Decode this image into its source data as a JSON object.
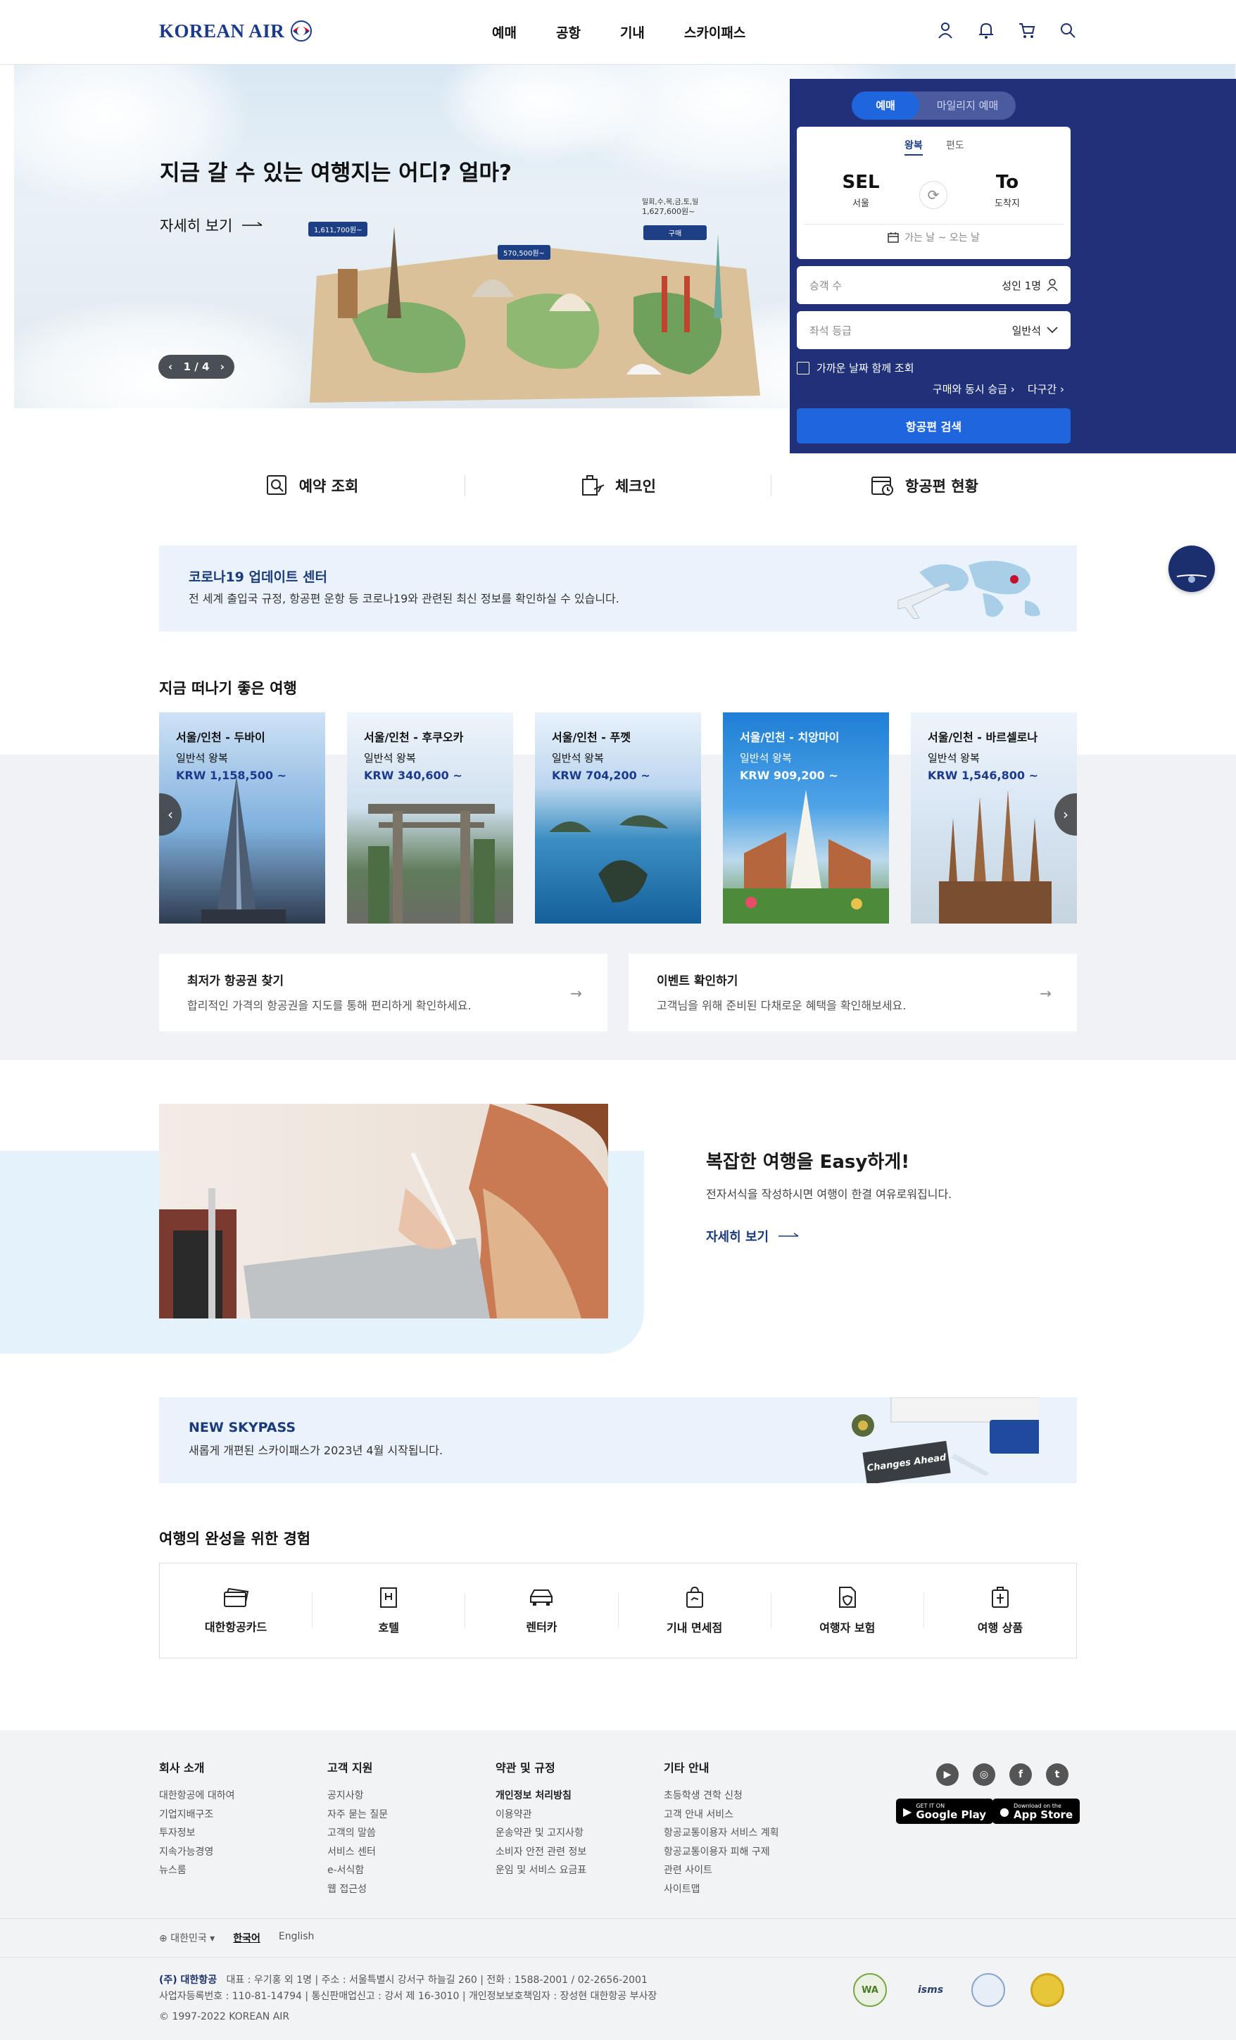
{
  "header": {
    "logo_text": "KOREAN AIR",
    "nav": [
      "예매",
      "공항",
      "기내",
      "스카이패스"
    ]
  },
  "hero": {
    "title": "지금 갈 수 있는 여행지는 어디? 얼마?",
    "more": "자세히 보기",
    "pager": "1 / 4",
    "tags": [
      "1,611,700원~",
      "570,500원~",
      "1,627,600원~"
    ],
    "tag_cities": "밀회,수,목,금,토,일",
    "tag_buy": "구매"
  },
  "booking": {
    "tab_active": "예매",
    "tab_other": "마일리지 예매",
    "trip_round": "왕복",
    "trip_oneway": "편도",
    "from_code": "SEL",
    "from_city": "서울",
    "to_code": "To",
    "to_city": "도착지",
    "date_placeholder": "가는 날 ~ 오는 날",
    "passenger_label": "승객 수",
    "passenger_value": "성인 1명",
    "class_label": "좌석 등급",
    "class_value": "일반석",
    "nearby": "가까운 날짜 함께 조회",
    "link1": "구매와 동시 승급",
    "link2": "다구간",
    "search": "항공편 검색"
  },
  "quick": [
    "예약 조회",
    "체크인",
    "항공편 현황"
  ],
  "covid": {
    "title": "코로나19 업데이트 센터",
    "desc": "전 세계 출입국 규정, 항공편 운항 등 코로나19와 관련된 최신 정보를 확인하실 수 있습니다."
  },
  "destinations": {
    "heading": "지금 떠나기 좋은 여행",
    "cards": [
      {
        "route": "서울/인천 - 두바이",
        "cabin": "일반석 왕복",
        "price": "KRW 1,158,500 ~"
      },
      {
        "route": "서울/인천 - 후쿠오카",
        "cabin": "일반석 왕복",
        "price": "KRW 340,600 ~"
      },
      {
        "route": "서울/인천 - 푸껫",
        "cabin": "일반석 왕복",
        "price": "KRW 704,200 ~"
      },
      {
        "route": "서울/인천 - 치앙마이",
        "cabin": "일반석 왕복",
        "price": "KRW 909,200 ~"
      },
      {
        "route": "서울/인천 - 바르셀로나",
        "cabin": "일반석 왕복",
        "price": "KRW 1,546,800 ~"
      }
    ]
  },
  "promos": [
    {
      "title": "최저가 항공권 찾기",
      "desc": "합리적인 가격의 항공권을 지도를 통해 편리하게 확인하세요."
    },
    {
      "title": "이벤트 확인하기",
      "desc": "고객님을 위해 준비된 다채로운 혜택을 확인해보세요."
    }
  ],
  "easy": {
    "title": "복잡한 여행을 Easy하게!",
    "desc": "전자서식을 작성하시면 여행이 한결 여유로워집니다.",
    "more": "자세히 보기"
  },
  "skypass": {
    "title": "NEW SKYPASS",
    "desc": "새롭게 개편된 스카이패스가 2023년 4월 시작됩니다.",
    "card_text": "Changes Ahead"
  },
  "services": {
    "heading": "여행의 완성을 위한 경험",
    "items": [
      "대한항공카드",
      "호텔",
      "렌터카",
      "기내 면세점",
      "여행자 보험",
      "여행 상품"
    ]
  },
  "footer": {
    "cols": [
      {
        "head": "회사 소개",
        "items": [
          "대한항공에 대하여",
          "기업지배구조",
          "투자정보",
          "지속가능경영",
          "뉴스룸"
        ]
      },
      {
        "head": "고객 지원",
        "items": [
          "공지사항",
          "자주 묻는 질문",
          "고객의 말씀",
          "서비스 센터",
          "e-서식함",
          "웹 접근성"
        ]
      },
      {
        "head": "약관 및 규정",
        "items": [
          "개인정보 처리방침",
          "이용약관",
          "운송약관 및 고지사항",
          "소비자 안전 관련 정보",
          "운임 및 서비스 요금표"
        ]
      },
      {
        "head": "기타 안내",
        "items": [
          "초등학생 견학 신청",
          "고객 안내 서비스",
          "항공교통이용자 서비스 계획",
          "항공교통이용자 피해 구제",
          "관련 사이트",
          "사이트맵"
        ]
      }
    ],
    "google_small": "GET IT ON",
    "google": "Google Play",
    "apple_small": "Download on the",
    "apple": "App Store",
    "country": "대한민국",
    "lang_ko": "한국어",
    "lang_en": "English",
    "corp_name": "(주) 대한항공",
    "corp_line1": "대표 : 우기홍 외 1명  |  주소 : 서울특별시 강서구 하늘길 260  |  전화 : 1588-2001 / 02-2656-2001",
    "corp_line2": "사업자등록번호 : 110-81-14794  |  통신판매업신고 : 강서 제 16-3010  |  개인정보보호책임자 : 장성현 대한항공 부사장",
    "copyright": "© 1997-2022 KOREAN AIR",
    "cert_labels": [
      "WA",
      "isms"
    ]
  }
}
